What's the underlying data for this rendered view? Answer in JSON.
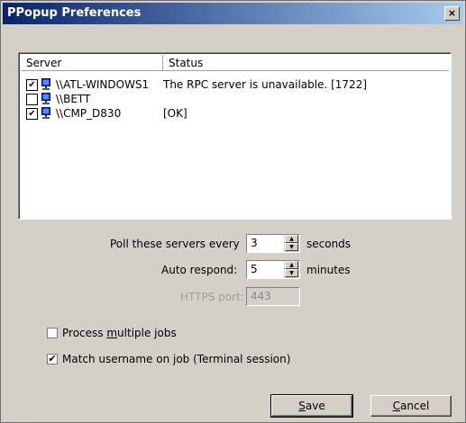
{
  "window": {
    "title": "PPopup Preferences",
    "close_label": "×"
  },
  "list": {
    "headers": {
      "server": "Server",
      "status": "Status"
    },
    "rows": [
      {
        "checked": true,
        "checkmark": "✔",
        "server": "\\\\ATL-WINDOWS1",
        "status": "The RPC server is unavailable. [1722]"
      },
      {
        "checked": false,
        "checkmark": "",
        "server": "\\\\BETT",
        "status": ""
      },
      {
        "checked": true,
        "checkmark": "✔",
        "server": "\\\\CMP_D830",
        "status": "[OK]"
      }
    ]
  },
  "poll": {
    "label": "Poll these servers every",
    "value": "3",
    "unit": "seconds"
  },
  "auto_respond": {
    "label": "Auto respond:",
    "value": "5",
    "unit": "minutes"
  },
  "https": {
    "label": "HTTPS port:",
    "value": "443"
  },
  "options": {
    "process_multiple": {
      "label_pre": "Process ",
      "label_accel": "m",
      "label_post": "ultiple jobs",
      "checked": false,
      "checkmark": ""
    },
    "match_username": {
      "label": "Match username on job (Terminal session)",
      "checked": true,
      "checkmark": "✔"
    }
  },
  "buttons": {
    "save": {
      "accel": "S",
      "rest": "ave"
    },
    "cancel": {
      "accel": "C",
      "rest": "ancel"
    }
  }
}
